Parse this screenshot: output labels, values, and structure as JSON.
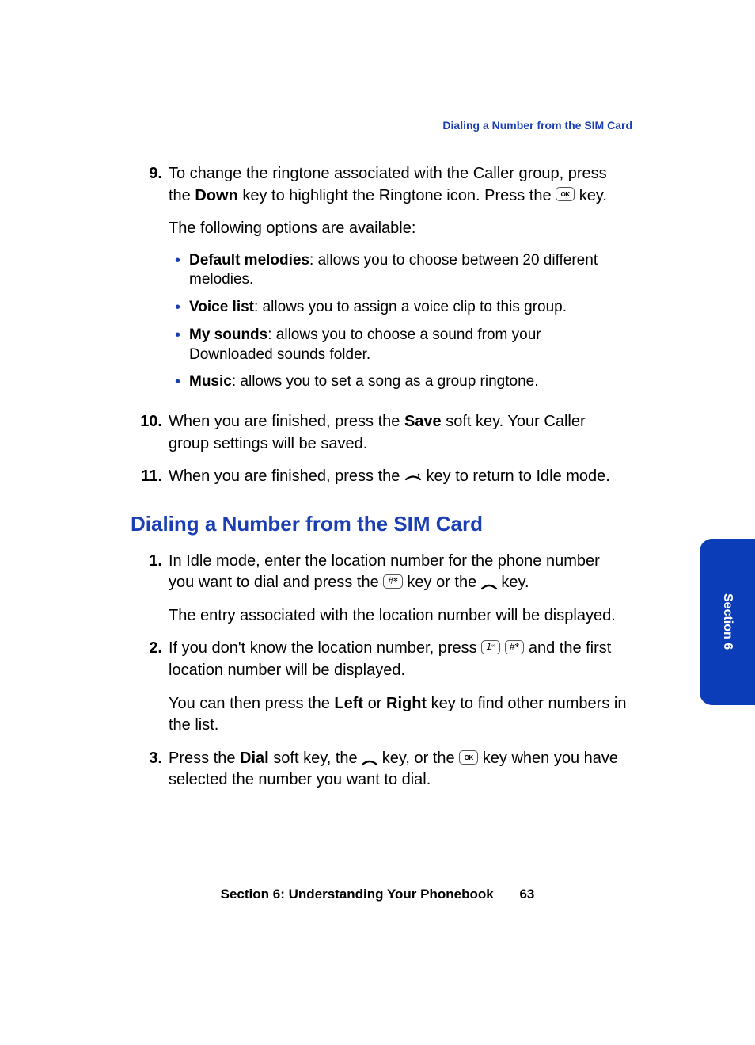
{
  "header": {
    "running": "Dialing a Number from the SIM Card"
  },
  "steps_a": {
    "nine": {
      "num": "9.",
      "p1_a": "To change the ringtone associated with the Caller group, press the ",
      "p1_bold": "Down",
      "p1_b": " key to highlight the Ringtone icon. Press the ",
      "p1_c": " key.",
      "p2": "The following options are available:",
      "bullets": {
        "b1_bold": "Default melodies",
        "b1_rest": ": allows you to choose between 20 different melodies.",
        "b2_bold": "Voice list",
        "b2_rest": ": allows you to assign a voice clip to this group.",
        "b3_bold": "My sounds",
        "b3_rest": ": allows you to choose a sound from your Downloaded sounds folder.",
        "b4_bold": "Music",
        "b4_rest": ": allows you to set a song as a group ringtone."
      }
    },
    "ten": {
      "num": "10.",
      "a": "When you are finished, press the ",
      "bold": "Save",
      "b": " soft key. Your Caller group settings will be saved."
    },
    "eleven": {
      "num": "11.",
      "a": "When you are finished, press the ",
      "b": " key to return to Idle mode."
    }
  },
  "section_title": "Dialing a Number from the SIM Card",
  "steps_b": {
    "one": {
      "num": "1.",
      "p1_a": "In Idle mode, enter the location number for the phone number you want to dial and press the ",
      "p1_b": " key or the ",
      "p1_c": " key.",
      "p2": "The entry associated with the location number will be displayed."
    },
    "two": {
      "num": "2.",
      "p1_a": "If you don't know the location number, press ",
      "p1_b": " and the first location number will be displayed.",
      "p2_a": "You can then press the ",
      "p2_left": "Left",
      "p2_or": " or ",
      "p2_right": "Right",
      "p2_b": " key to find other numbers in the list."
    },
    "three": {
      "num": "3.",
      "a": "Press the ",
      "dial": "Dial",
      "b": " soft key, the ",
      "c": " key, or the ",
      "d": " key when you have selected the number you want to dial."
    }
  },
  "keys": {
    "ok": "OK",
    "hash": "#",
    "one": "1"
  },
  "side_tab": "Section 6",
  "footer": {
    "section": "Section 6: Understanding Your Phonebook",
    "page": "63"
  }
}
